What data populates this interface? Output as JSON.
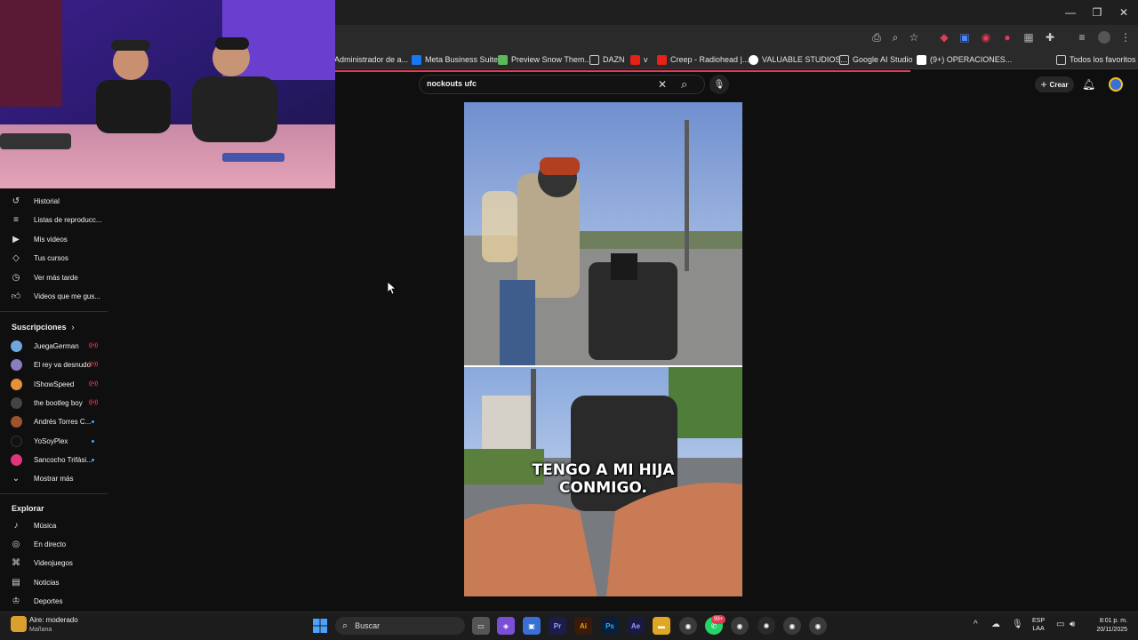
{
  "browser": {
    "bookmarks": [
      "Administrador de a...",
      "Meta Business Suite",
      "Preview Snow Them...",
      "DAZN",
      "v",
      "Creep - Radiohead |...",
      "VALUABLE STUDIOS...",
      "Google AI Studio",
      "(9+) OPERACIONES..."
    ],
    "all_bookmarks": "Todos los favoritos"
  },
  "youtube": {
    "search_value": "nockouts ufc",
    "create_label": "Crear",
    "video_caption_line1": "TENGO A MI HIJA",
    "video_caption_line2": "CONMIGO."
  },
  "sidebar": {
    "you_items": [
      {
        "label": "Historial",
        "icon": "history-icon"
      },
      {
        "label": "Listas de reproducc...",
        "icon": "playlist-icon"
      },
      {
        "label": "Mis videos",
        "icon": "my-videos-icon"
      },
      {
        "label": "Tus cursos",
        "icon": "courses-icon"
      },
      {
        "label": "Ver más tarde",
        "icon": "watch-later-icon"
      },
      {
        "label": "Videos que me gus...",
        "icon": "liked-icon"
      }
    ],
    "subscriptions_title": "Suscripciones",
    "subscriptions": [
      {
        "label": "JuegaGerman",
        "color": "#6fa8dc",
        "live": true
      },
      {
        "label": "El rey va desnudo",
        "color": "#8e7cc3",
        "live": true
      },
      {
        "label": "IShowSpeed",
        "color": "#e69138",
        "live": true
      },
      {
        "label": "the bootleg boy",
        "color": "#444444",
        "live": true
      },
      {
        "label": "Andrés Torres C...",
        "color": "#a0522d",
        "live": false
      },
      {
        "label": "YoSoyPlex",
        "color": "#111111",
        "live": false
      },
      {
        "label": "Sancocho Trifási...",
        "color": "#e0357a",
        "live": false
      }
    ],
    "show_more": "Mostrar más",
    "explore_title": "Explorar",
    "explore": [
      {
        "label": "Música",
        "icon": "music-icon"
      },
      {
        "label": "En directo",
        "icon": "live-icon"
      },
      {
        "label": "Videojuegos",
        "icon": "gaming-icon"
      },
      {
        "label": "Noticias",
        "icon": "news-icon"
      },
      {
        "label": "Deportes",
        "icon": "sports-icon"
      }
    ]
  },
  "taskbar": {
    "weather_title": "Aire: moderado",
    "weather_sub": "Mañana",
    "search_label": "Buscar",
    "lang_1": "ESP",
    "lang_2": "LAA",
    "time": "8:01 p. m.",
    "date": "20/11/2025",
    "badge": "99+"
  },
  "colors": {
    "accent_red": "#e33b55",
    "dark_bg": "#0f0f0f"
  }
}
